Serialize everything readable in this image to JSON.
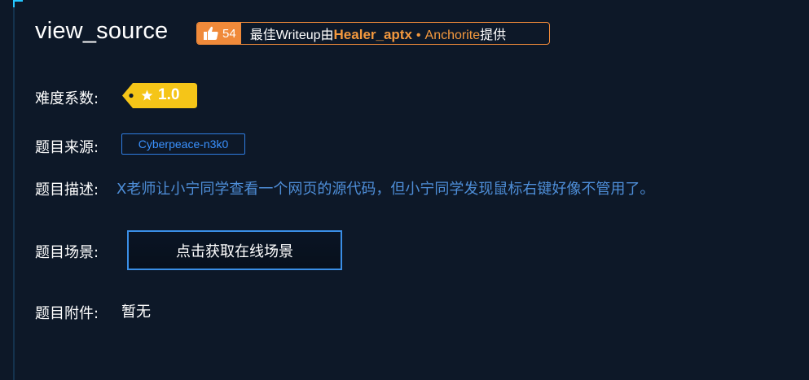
{
  "challenge": {
    "title": "view_source"
  },
  "writeup": {
    "likes": "54",
    "prefix": "最佳Writeup由",
    "author": "Healer_aptx",
    "separator": "•",
    "team": "Anchorite",
    "suffix": "提供"
  },
  "difficulty": {
    "label": "难度系数:",
    "value": "1.0"
  },
  "source": {
    "label": "题目来源:",
    "value": "Cyberpeace-n3k0"
  },
  "description": {
    "label": "题目描述:",
    "text": "X老师让小宁同学查看一个网页的源代码，但小宁同学发现鼠标右键好像不管用了。"
  },
  "scene": {
    "label": "题目场景:",
    "button_label": "点击获取在线场景"
  },
  "attachment": {
    "label": "题目附件:",
    "value": "暂无"
  },
  "colors": {
    "background": "#0d1828",
    "accent_orange": "#f08a3a",
    "tag_yellow": "#f5c518",
    "link_blue": "#3a92ff",
    "description_blue": "#4e8ed8"
  },
  "icons": [
    "thumbs-up-icon",
    "star-icon",
    "tag-hole-icon"
  ]
}
